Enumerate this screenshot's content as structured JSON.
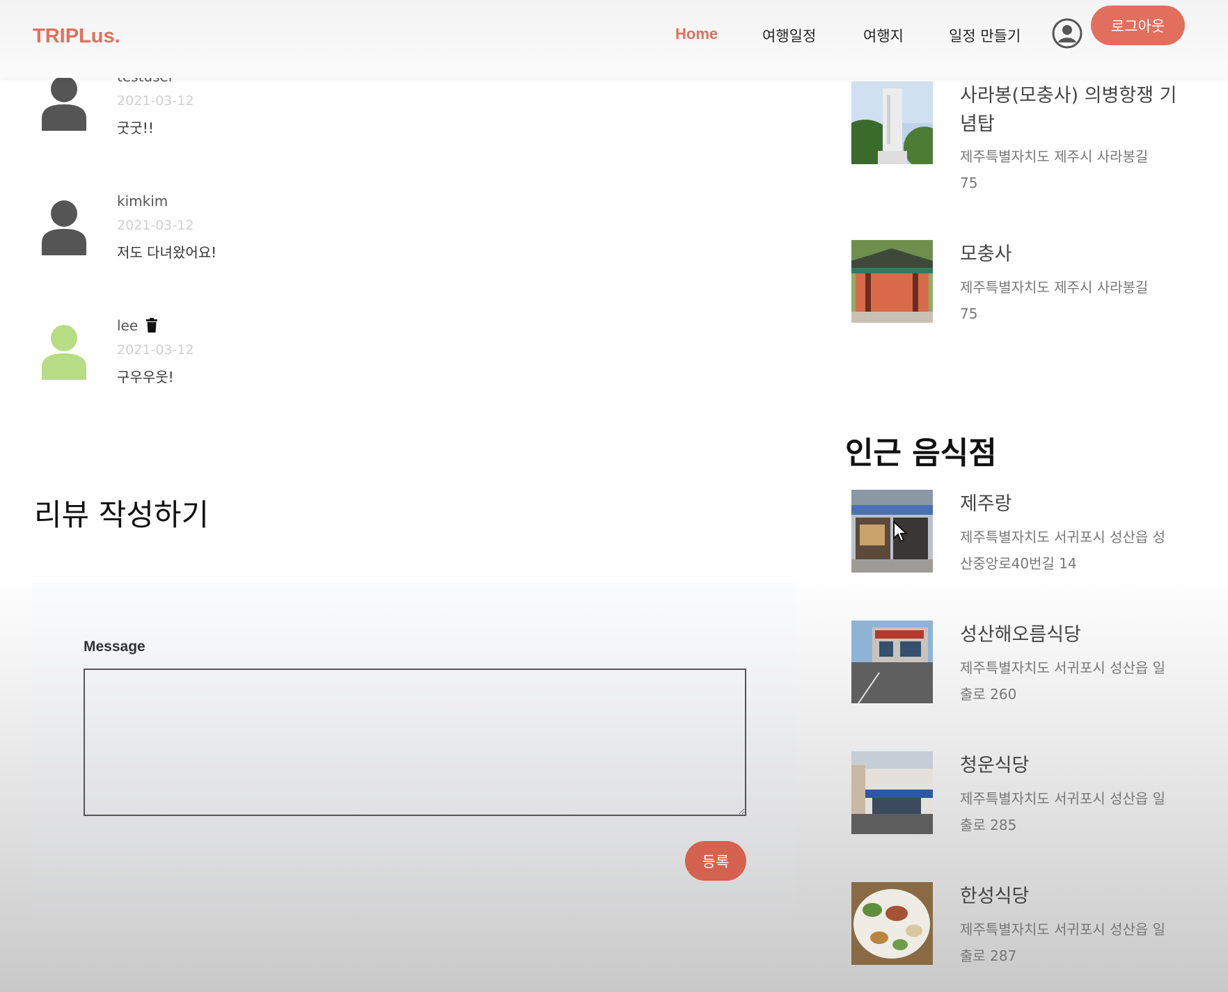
{
  "header": {
    "logo": "TRIPLus.",
    "nav": [
      "Home",
      "여행일정",
      "여행지",
      "일정 만들기"
    ],
    "logout_label": "로그아웃"
  },
  "comments": [
    {
      "author": "testuser",
      "date": "2021-03-12",
      "text": "굿굿!!"
    },
    {
      "author": "kimkim",
      "date": "2021-03-12",
      "text": "저도 다녀왔어요!"
    },
    {
      "author": "lee",
      "date": "2021-03-12",
      "text": "구우우웃!"
    }
  ],
  "review_form": {
    "title": "리뷰 작성하기",
    "message_label": "Message",
    "message_value": "",
    "submit_label": "등록"
  },
  "nearby_places": [
    {
      "name": "사라봉(모충사) 의병항쟁 기념탑",
      "address": "제주특별자치도 제주시 사라봉길 75"
    },
    {
      "name": "모충사",
      "address": "제주특별자치도 제주시 사라봉길 75"
    }
  ],
  "nearby_restaurants": {
    "title": "인근 음식점",
    "items": [
      {
        "name": "제주랑",
        "address": "제주특별자치도 서귀포시 성산읍 성산중앙로40번길 14"
      },
      {
        "name": "성산해오름식당",
        "address": "제주특별자치도 서귀포시 성산읍 일출로 260"
      },
      {
        "name": "청운식당",
        "address": "제주특별자치도 서귀포시 성산읍 일출로 285"
      },
      {
        "name": "한성식당",
        "address": "제주특별자치도 서귀포시 성산읍 일출로 287"
      }
    ]
  },
  "colors": {
    "accent": "#e26f5e",
    "avatar_default": "#555555",
    "avatar_owner": "#b7dd84"
  }
}
